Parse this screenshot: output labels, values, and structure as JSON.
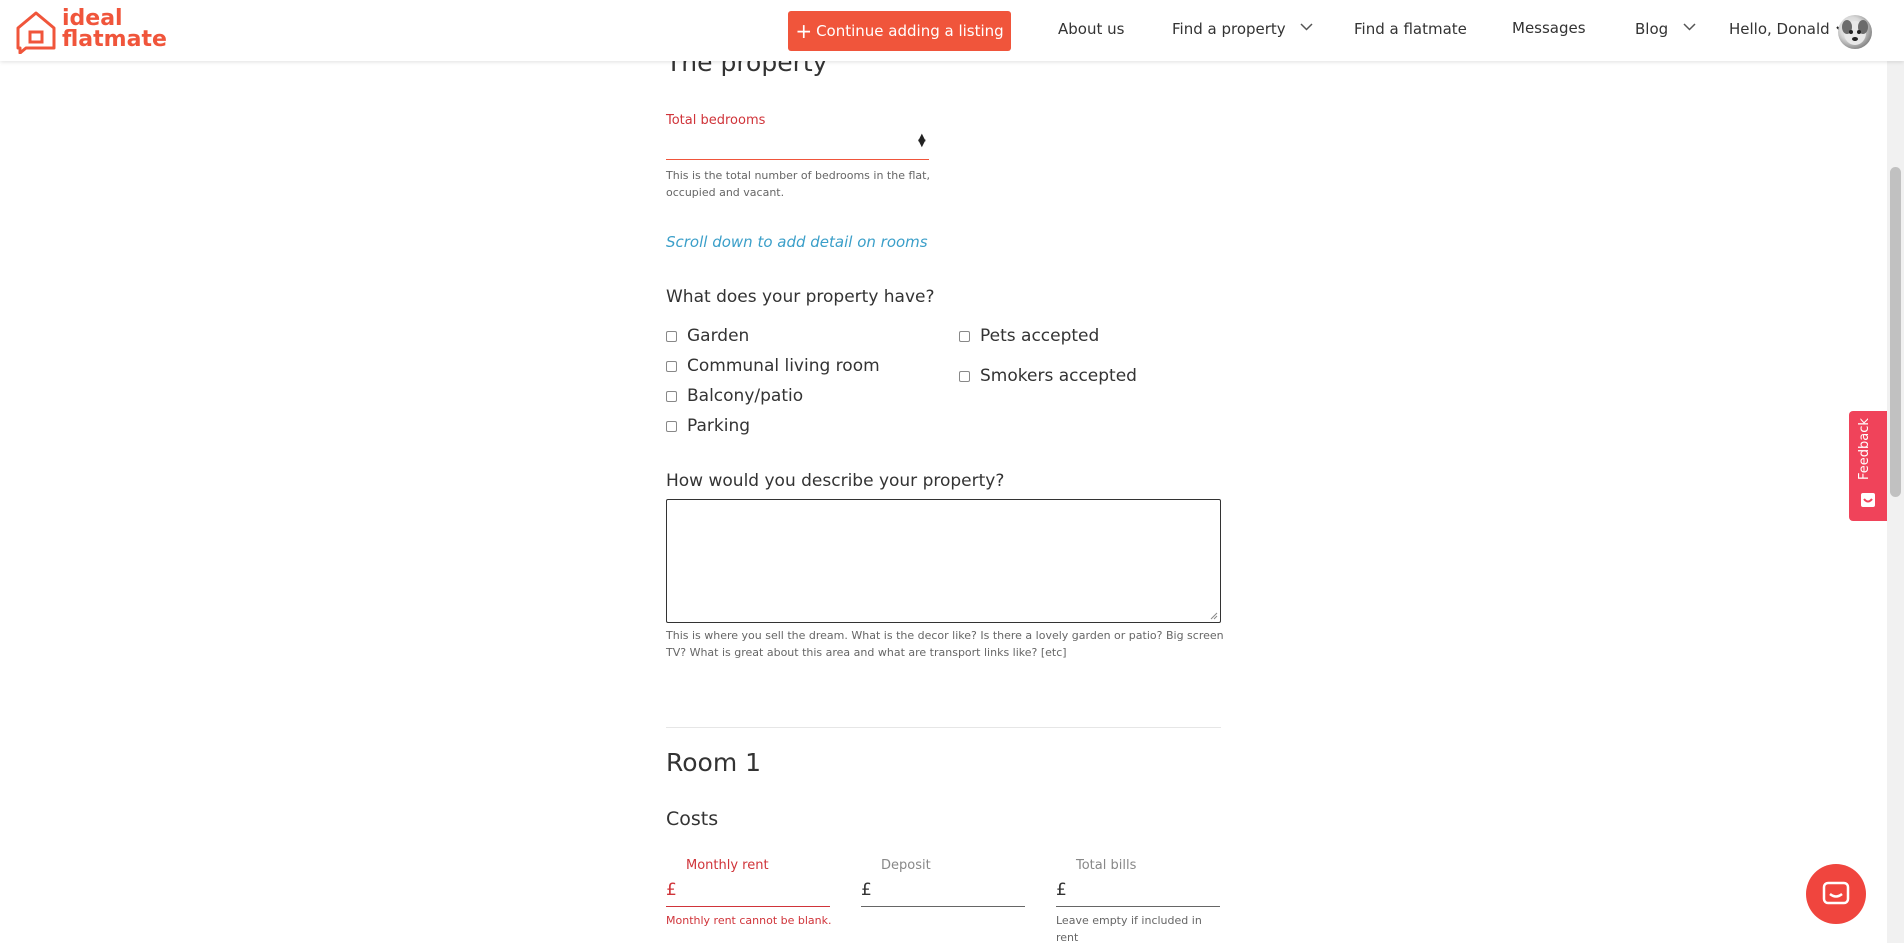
{
  "header": {
    "logo_line1": "ideal",
    "logo_line2": "flatmate",
    "cta_label": "Continue adding a listing",
    "nav": {
      "about": "About us",
      "find_property": "Find a property",
      "find_flatmate": "Find a flatmate",
      "messages": "Messages",
      "blog": "Blog",
      "account": "Hello, Donald"
    }
  },
  "property": {
    "title": "The property",
    "bedrooms_label": "Total bedrooms",
    "bedrooms_help_1": "This is the total number of bedrooms in the flat,",
    "bedrooms_help_2": "occupied and vacant.",
    "scroll_link": "Scroll down to add detail on rooms",
    "features_question": "What does your property have?",
    "features_left": [
      "Garden",
      "Communal living room",
      "Balcony/patio",
      "Parking"
    ],
    "features_right": [
      "Pets accepted",
      "Smokers accepted"
    ],
    "describe_question": "How would you describe your property?",
    "describe_help_1": "This is where you sell the dream. What is the decor like? Is there a lovely garden or patio? Big screen",
    "describe_help_2": "TV? What is great about this area and what are transport links like? [etc]"
  },
  "room": {
    "title": "Room 1",
    "costs_title": "Costs",
    "currency": "£",
    "monthly_rent_label": "Monthly rent",
    "monthly_rent_error": "Monthly rent cannot be blank.",
    "deposit_label": "Deposit",
    "bills_label": "Total bills",
    "bills_help_1": "Leave empty if included in",
    "bills_help_2": "rent"
  },
  "feedback": {
    "label": "Feedback"
  },
  "colors": {
    "brand": "#f0553b",
    "error": "#d0343a",
    "link": "#3b9fc9",
    "feedback": "#f0435a"
  }
}
